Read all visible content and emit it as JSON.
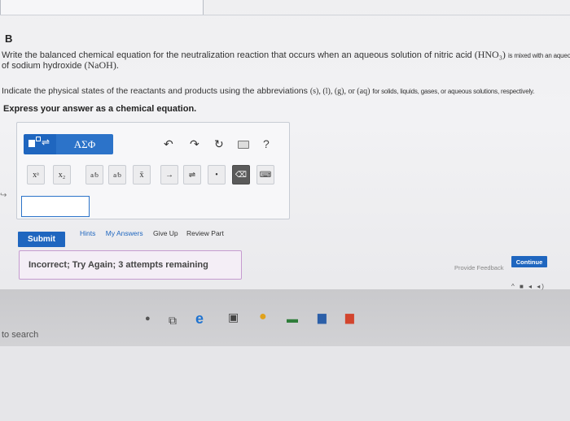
{
  "problem": {
    "part": "B",
    "q_line1_a": "Write the balanced chemical equation for the neutralization reaction that occurs when an aqueous solution of nitric acid",
    "q_formula_acid": "(HNO₃)",
    "q_line1_b": "is mixed with an aqueous solution",
    "q_line2_a": "of sodium hydroxide",
    "q_formula_base": "(NaOH).",
    "q_states_a": "Indicate the physical states of the reactants and products using the abbreviations",
    "q_states_abbr": "(s), (l), (g), or (aq)",
    "q_states_b": "for solids, liquids, gases, or aqueous solutions, respectively.",
    "instruction": "Express your answer as a chemical equation."
  },
  "editor": {
    "symbols_label": "ΑΣΦ",
    "help_label": "?",
    "keys": {
      "superscript": "xᵃ",
      "subscript": "x₂",
      "fraction": "a/b",
      "mixed": "a/b",
      "bar": "x̄",
      "arrow": "→",
      "equilibrium": "⇌",
      "dot": "•",
      "delete": "⌫",
      "keyboard": "⌨"
    },
    "answer_value": ""
  },
  "actions": {
    "submit": "Submit",
    "hints": "Hints",
    "my_answers": "My Answers",
    "give_up": "Give Up",
    "review_part": "Review Part"
  },
  "feedback": {
    "message": "Incorrect; Try Again; 3 attempts remaining"
  },
  "footer": {
    "provide_feedback": "Provide Feedback",
    "continue": "Continue"
  },
  "taskbar": {
    "search_text": "to search"
  }
}
